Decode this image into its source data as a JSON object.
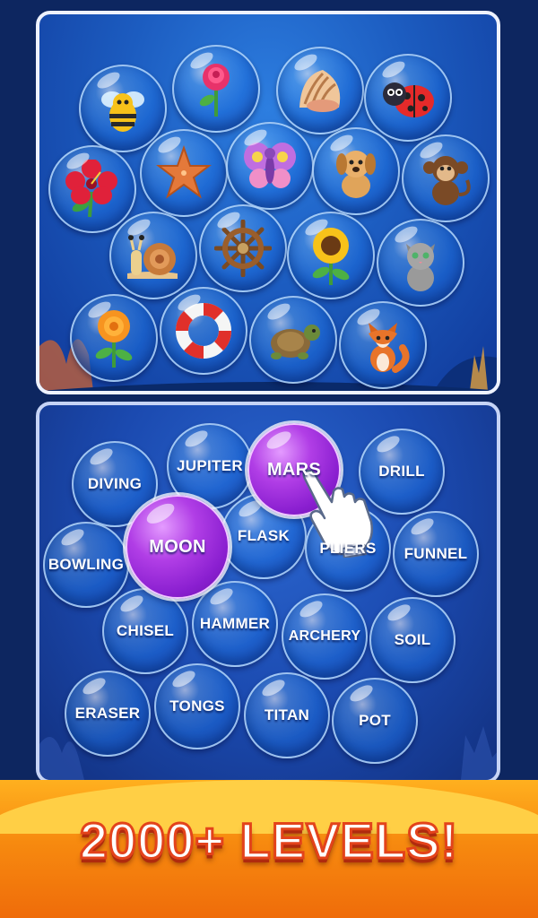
{
  "picture_board": {
    "items": [
      "bee",
      "rose",
      "seashell",
      "ladybug",
      "hibiscus",
      "starfish",
      "butterfly",
      "puppy",
      "monkey",
      "snail",
      "ship-wheel",
      "sunflower",
      "kitten",
      "marigold",
      "life-ring",
      "turtle",
      "fox"
    ]
  },
  "word_board": {
    "words": [
      "DIVING",
      "JUPITER",
      "MARS",
      "DRILL",
      "MOON",
      "FLASK",
      "PLIERS",
      "BOWLING",
      "FUNNEL",
      "CHISEL",
      "HAMMER",
      "ARCHERY",
      "SOIL",
      "ERASER",
      "TONGS",
      "TITAN",
      "POT"
    ],
    "selected": [
      "MARS",
      "MOON"
    ],
    "selected_color": "#9a2ad8"
  },
  "banner": {
    "text": "2000+ LEVELS!"
  },
  "colors": {
    "accent": "#f78a0f",
    "panel_border": "#eef2ff",
    "ocean": "#1c5cc0"
  }
}
